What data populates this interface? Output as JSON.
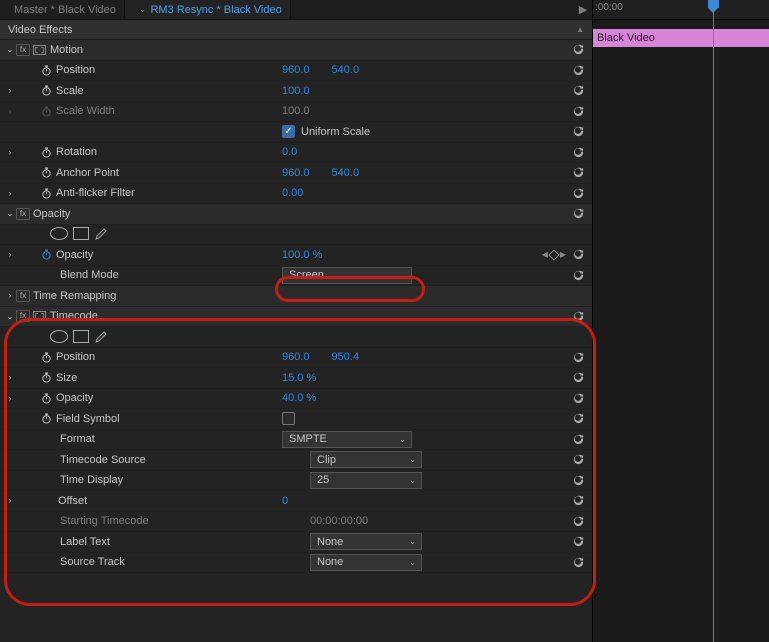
{
  "tabs": {
    "master": "Master * Black Video",
    "clip": "RM3 Resync * Black Video"
  },
  "section_title": "Video Effects",
  "timeline": {
    "tick0": ":00:00",
    "clip_label": "Black Video"
  },
  "effects": {
    "motion": {
      "name": "Motion",
      "position": {
        "label": "Position",
        "x": "960.0",
        "y": "540.0"
      },
      "scale": {
        "label": "Scale",
        "value": "100.0"
      },
      "scale_width": {
        "label": "Scale Width",
        "value": "100.0"
      },
      "uniform": {
        "label": "Uniform Scale"
      },
      "rotation": {
        "label": "Rotation",
        "value": "0.0"
      },
      "anchor": {
        "label": "Anchor Point",
        "x": "960.0",
        "y": "540.0"
      },
      "antiflicker": {
        "label": "Anti-flicker Filter",
        "value": "0.00"
      }
    },
    "opacity_fx": {
      "name": "Opacity",
      "opacity": {
        "label": "Opacity",
        "value": "100.0 %"
      },
      "blend": {
        "label": "Blend Mode",
        "value": "Screen"
      }
    },
    "time_remap": {
      "name": "Time Remapping"
    },
    "timecode": {
      "name": "Timecode",
      "position": {
        "label": "Position",
        "x": "960.0",
        "y": "950.4"
      },
      "size": {
        "label": "Size",
        "value": "15.0 %"
      },
      "opacity": {
        "label": "Opacity",
        "value": "40.0 %"
      },
      "field_symbol": {
        "label": "Field Symbol"
      },
      "format": {
        "label": "Format",
        "value": "SMPTE"
      },
      "tc_source": {
        "label": "Timecode Source",
        "value": "Clip"
      },
      "time_display": {
        "label": "Time Display",
        "value": "25"
      },
      "offset": {
        "label": "Offset",
        "value": "0"
      },
      "starting_tc": {
        "label": "Starting Timecode",
        "value": "00:00:00:00"
      },
      "label_text": {
        "label": "Label Text",
        "value": "None"
      },
      "source_track": {
        "label": "Source Track",
        "value": "None"
      }
    }
  }
}
